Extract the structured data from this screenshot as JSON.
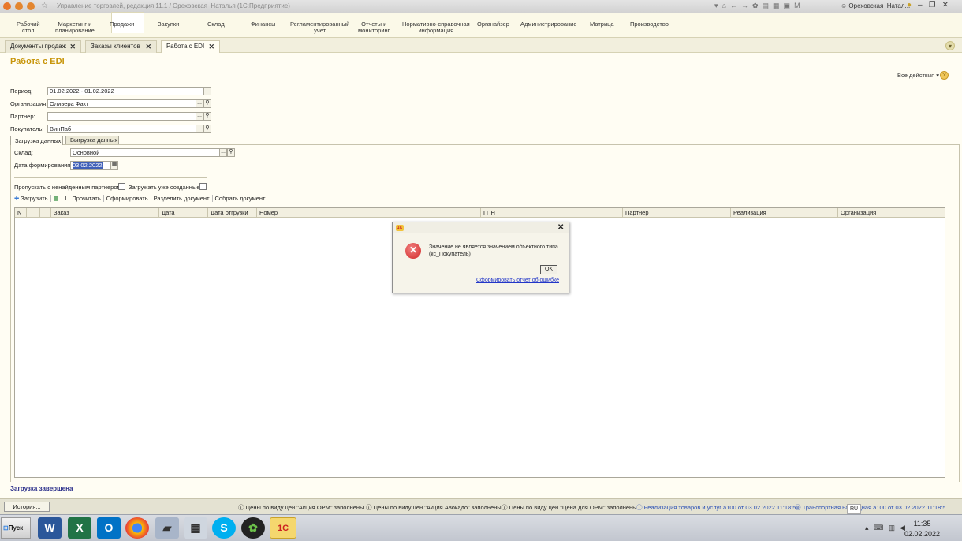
{
  "window": {
    "title": "Управление торговлей, редакция 11.1 / Ореховская_Наталья (1С:Предприятие)",
    "user": "Ореховская_Натал..."
  },
  "sections": [
    {
      "label": "Рабочий\nстол"
    },
    {
      "label": "Маркетинг и\nпланирование"
    },
    {
      "label": "Продажи"
    },
    {
      "label": "Закупки"
    },
    {
      "label": "Склад"
    },
    {
      "label": "Финансы"
    },
    {
      "label": "Регламентированный\nучет"
    },
    {
      "label": "Отчеты и\nмониторинг"
    },
    {
      "label": "Нормативно-справочная\nинформация"
    },
    {
      "label": "Органайзер"
    },
    {
      "label": "Администрирование"
    },
    {
      "label": "Матрица"
    },
    {
      "label": "Производство"
    }
  ],
  "tabs": [
    {
      "label": "Документы продаж"
    },
    {
      "label": "Заказы клиентов"
    },
    {
      "label": "Работа с EDI"
    }
  ],
  "page": {
    "title": "Работа с EDI",
    "all_actions": "Все действия ▾"
  },
  "filters": {
    "period_label": "Период:",
    "period_value": "01.02.2022 - 01.02.2022",
    "org_label": "Организация:",
    "org_value": "Оливера Факт",
    "partner_label": "Партнер:",
    "partner_value": "",
    "buyer_label": "Покупатель:",
    "buyer_value": "ВинПаб"
  },
  "form_tabs": [
    "Загрузка данных",
    "Выгрузка данных"
  ],
  "load": {
    "warehouse_label": "Склад:",
    "warehouse_value": "Основной",
    "date_label": "Дата формирования:",
    "date_value": "03.02.2022",
    "skip_label": "Пропускать с ненайденным партнером:",
    "load_existing_label": "Загружать уже созданные:"
  },
  "toolbar": {
    "load": "Загрузить",
    "read": "Прочитать",
    "form": "Сформировать",
    "split": "Разделить документ",
    "collect": "Собрать документ"
  },
  "grid": {
    "columns": [
      "N",
      "",
      "Заказ",
      "Дата",
      "Дата отгрузки",
      "Номер",
      "",
      "ГПН",
      "Партнер",
      "Реализация",
      "Организация"
    ]
  },
  "dialog": {
    "message": "Значение не является значением объектного типа (кс_Покупатель)",
    "ok": "OK",
    "report_link": "Сформировать отчет об ошибке"
  },
  "status": {
    "done": "Загрузка завершена"
  },
  "bottom": {
    "history": "История...",
    "messages": [
      "Цены по виду цен \"Акция ОРМ\" заполнены",
      "Цены по виду цен \"Акция Авокадо\" заполнены",
      "Цены по виду цен \"Цена для ОРМ\" заполнены",
      "Реализация товаров и услуг а100 от 03.02.2022 11:18:50",
      "Транспортная накладная а100 от 03.02.2022 11:18:50"
    ]
  },
  "taskbar": {
    "start": "Пуск",
    "lang": "RU",
    "time": "11:35",
    "date": "02.02.2022",
    "apps": [
      "word-icon",
      "excel-icon",
      "outlook-icon",
      "chrome-icon",
      "scanner-icon",
      "calculator-icon",
      "skype-icon",
      "media-icon",
      "1c-icon"
    ]
  }
}
